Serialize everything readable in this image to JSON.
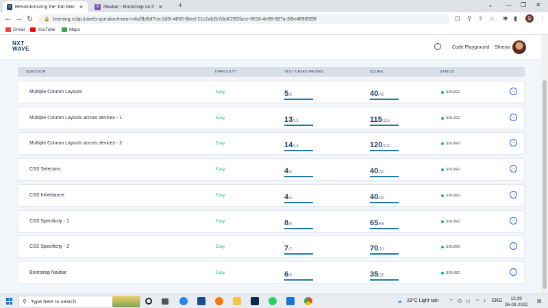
{
  "browser": {
    "tabs": [
      {
        "title": "Revolutionizing the Job Market |",
        "active": true
      },
      {
        "title": "Navbar - Bootstrap v4.5",
        "active": false
      }
    ],
    "url": "learning.ccbp.in/web-question/exam-info/9b9bf7ea-2d5f-4655-8bed-21c2ab2b7dc8/29f2face-0616-4e88-887a-3f6e4898559f",
    "profile_initial": "S",
    "bookmarks": [
      "Gmail",
      "YouTube",
      "Maps"
    ]
  },
  "header": {
    "logo_line1": "NXT",
    "logo_line2": "WAVE",
    "playground_label": "Code Playground",
    "user_name": "Shreya"
  },
  "table": {
    "columns": {
      "question": "QUESTION",
      "difficulty": "DIFFICULTY",
      "test_cases": "TEST CASES PASSED",
      "score": "SCORE",
      "status": "STATUS"
    },
    "rows": [
      {
        "question": "Multiple Column Layouts",
        "difficulty": "Easy",
        "passed": "5",
        "passed_total": "/5",
        "score": "40",
        "score_total": "/40",
        "status": "SOLVED"
      },
      {
        "question": "Multiple Column Layouts across devices - 1",
        "difficulty": "Easy",
        "passed": "13",
        "passed_total": "/13",
        "score": "115",
        "score_total": "/115",
        "status": "SOLVED"
      },
      {
        "question": "Multiple Column Layouts across devices - 2",
        "difficulty": "Easy",
        "passed": "14",
        "passed_total": "/14",
        "score": "120",
        "score_total": "/120",
        "status": "SOLVED"
      },
      {
        "question": "CSS Selectors",
        "difficulty": "Easy",
        "passed": "4",
        "passed_total": "/4",
        "score": "40",
        "score_total": "/40",
        "status": "SOLVED"
      },
      {
        "question": "CSS Inheritance",
        "difficulty": "Easy",
        "passed": "4",
        "passed_total": "/4",
        "score": "40",
        "score_total": "/40",
        "status": "SOLVED"
      },
      {
        "question": "CSS Specificity - 1",
        "difficulty": "Easy",
        "passed": "8",
        "passed_total": "/8",
        "score": "65",
        "score_total": "/65",
        "status": "SOLVED"
      },
      {
        "question": "CSS Specificity - 2",
        "difficulty": "Easy",
        "passed": "7",
        "passed_total": "/7",
        "score": "70",
        "score_total": "/70",
        "status": "SOLVED"
      },
      {
        "question": "Bootstrap Navbar",
        "difficulty": "Easy",
        "passed": "6",
        "passed_total": "/6",
        "score": "35",
        "score_total": "/35",
        "status": "SOLVED"
      }
    ]
  },
  "taskbar": {
    "search_placeholder": "Type here to search",
    "weather": "29°C  Light rain",
    "language": "ENG",
    "time": "12:39",
    "date": "06-09-2022"
  },
  "colors": {
    "accent": "#1b79a8",
    "easy": "#10b981",
    "solved_dot": "#10b981",
    "brand": "#183b56"
  }
}
